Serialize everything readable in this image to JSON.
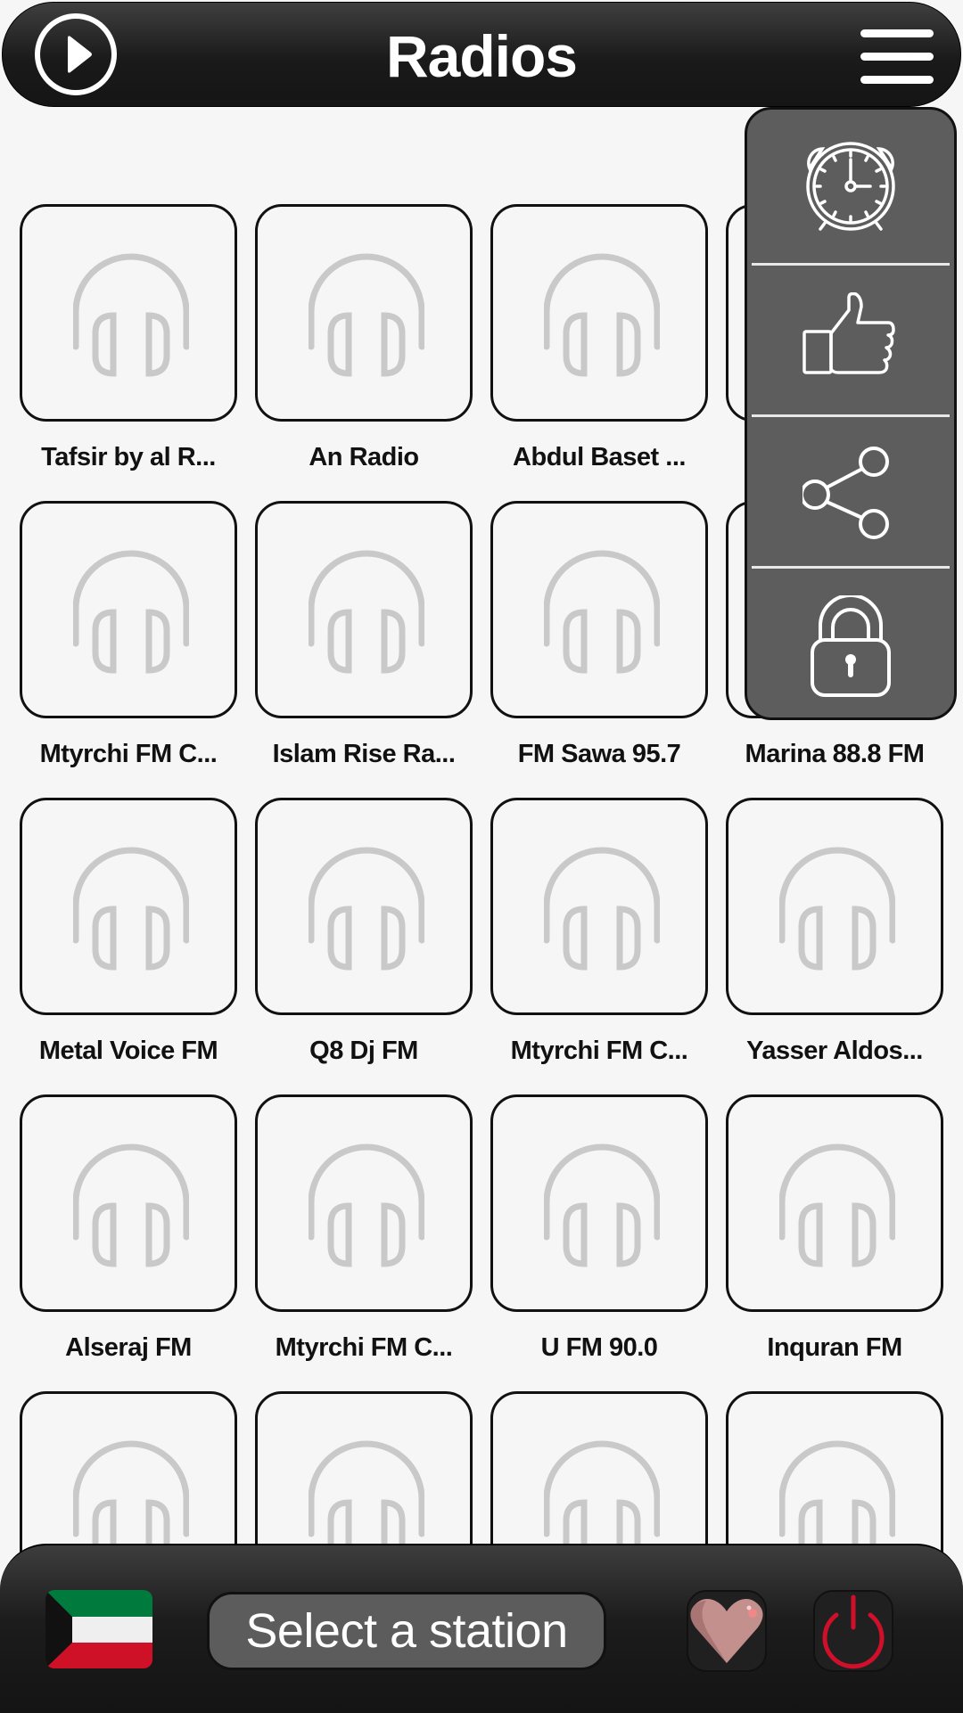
{
  "header": {
    "title": "Radios",
    "play_icon": "play-circle-icon",
    "menu_icon": "hamburger-menu-icon"
  },
  "stations": [
    {
      "name": "Tafsir by al R..."
    },
    {
      "name": "An Radio"
    },
    {
      "name": "Abdul Baset ..."
    },
    {
      "name": ""
    },
    {
      "name": "Mtyrchi FM C..."
    },
    {
      "name": "Islam Rise Ra..."
    },
    {
      "name": "FM Sawa 95.7"
    },
    {
      "name": "Marina 88.8 FM"
    },
    {
      "name": "Metal Voice FM"
    },
    {
      "name": "Q8 Dj FM"
    },
    {
      "name": "Mtyrchi FM C..."
    },
    {
      "name": "Yasser Aldos..."
    },
    {
      "name": "Alseraj FM"
    },
    {
      "name": "Mtyrchi FM C..."
    },
    {
      "name": "U FM 90.0"
    },
    {
      "name": "Inquran FM"
    },
    {
      "name": ""
    },
    {
      "name": ""
    },
    {
      "name": ""
    },
    {
      "name": ""
    }
  ],
  "station_placeholder_icon": "headphones-icon",
  "side_menu": {
    "items": [
      {
        "id": "alarm",
        "icon": "alarm-clock-icon"
      },
      {
        "id": "rate",
        "icon": "thumbs-up-icon"
      },
      {
        "id": "share",
        "icon": "share-icon"
      },
      {
        "id": "privacy",
        "icon": "lock-icon"
      }
    ]
  },
  "player": {
    "country_flag": "kuwait-flag",
    "station_text": "Select a station",
    "favorite_icon": "heart-icon",
    "power_icon": "power-icon"
  },
  "colors": {
    "bar_dark": "#1a1a1a",
    "menu_bg": "#5d5d5d",
    "page_bg": "#f6f6f6",
    "power_red": "#d0102a",
    "heart_pink": "#c4908e",
    "flag_green": "#007a3d",
    "flag_red": "#ce1126"
  }
}
